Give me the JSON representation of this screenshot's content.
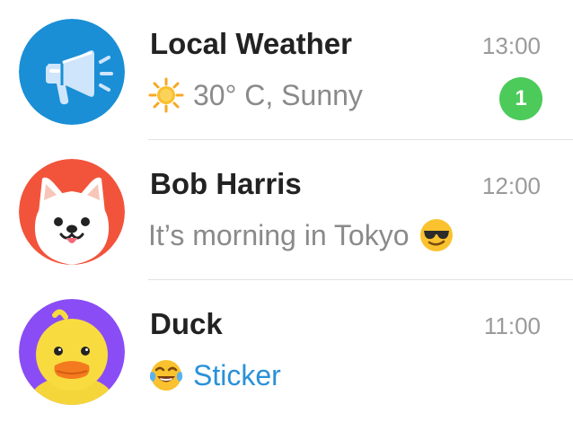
{
  "chats": [
    {
      "title": "Local Weather",
      "time": "13:00",
      "preview_emoji": "sun-emoji",
      "preview": "30° C, Sunny",
      "unread": "1",
      "avatar": "megaphone-icon",
      "avatar_color": "#1a8fd6"
    },
    {
      "title": "Bob Harris",
      "time": "12:00",
      "preview": "It’s morning in Tokyo",
      "preview_trailing_emoji": "sunglasses-emoji",
      "avatar": "dog-avatar",
      "avatar_color": "#f2543b"
    },
    {
      "title": "Duck",
      "time": "11:00",
      "preview_emoji": "tears-of-joy-emoji",
      "preview": "Sticker",
      "avatar": "duck-avatar",
      "avatar_color": "#8a4df5"
    }
  ],
  "colors": {
    "title": "#222222",
    "time": "#9a9a9a",
    "preview": "#8a8a8a",
    "sticker_link": "#2a91d8",
    "unread_badge": "#4cca5a",
    "separator": "#e2e2e2"
  }
}
